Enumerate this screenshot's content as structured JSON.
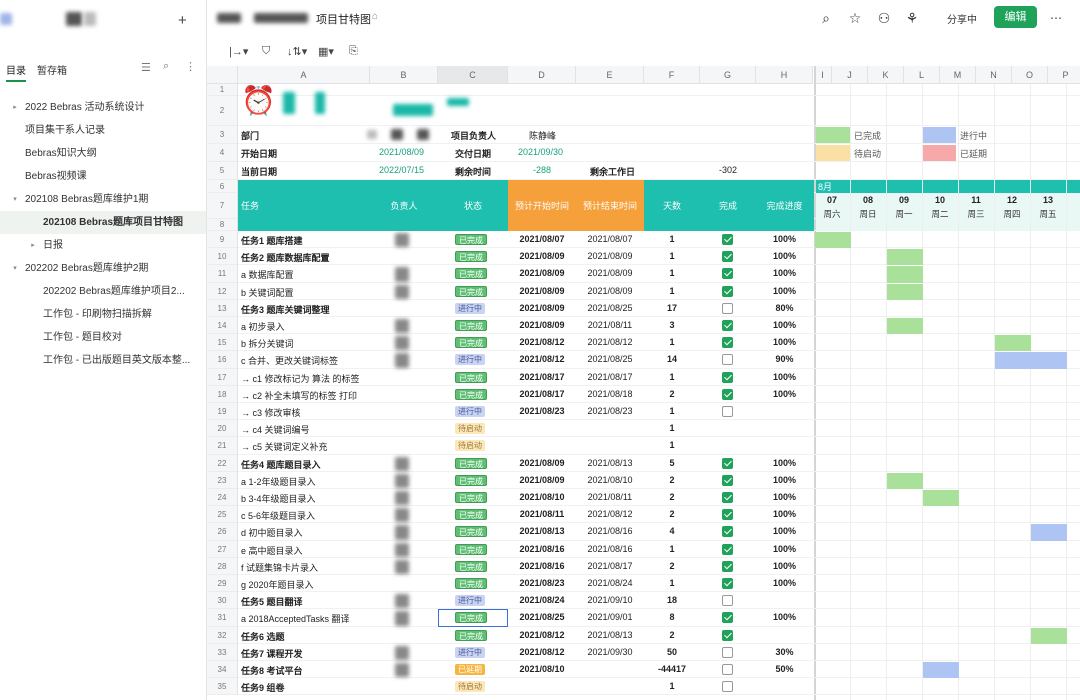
{
  "app": {
    "doc_title": "项目甘特图",
    "share_label": "分享中",
    "edit_label": "编辑"
  },
  "sidebar": {
    "tabs": [
      "目录",
      "暂存箱"
    ],
    "items": [
      {
        "label": "2022 Bebras 活动系统设计",
        "indent": 0,
        "caret": "right"
      },
      {
        "label": "项目集干系人记录",
        "indent": 0,
        "caret": ""
      },
      {
        "label": "Bebras知识大纲",
        "indent": 0,
        "caret": ""
      },
      {
        "label": "Bebras视频课",
        "indent": 0,
        "caret": ""
      },
      {
        "label": "202108 Bebras题库维护1期",
        "indent": 0,
        "caret": "down"
      },
      {
        "label": "202108 Bebras题库项目甘特图",
        "indent": 1,
        "caret": "",
        "selected": true
      },
      {
        "label": "日报",
        "indent": 1,
        "caret": "right"
      },
      {
        "label": "202202 Bebras题库维护2期",
        "indent": 0,
        "caret": "down"
      },
      {
        "label": "202202 Bebras题库维护项目2...",
        "indent": 1,
        "caret": ""
      },
      {
        "label": "工作包 - 印刷物扫描拆解",
        "indent": 1,
        "caret": ""
      },
      {
        "label": "工作包 - 题目校对",
        "indent": 1,
        "caret": ""
      },
      {
        "label": "工作包 - 已出版题目英文版本整...",
        "indent": 1,
        "caret": ""
      }
    ]
  },
  "toolbar": {
    "tools": [
      "|→▾",
      "⛉",
      "↓⇅▾",
      "▦▾",
      "⎘"
    ]
  },
  "columns": [
    "A",
    "B",
    "C",
    "D",
    "E",
    "F",
    "G",
    "H",
    "I",
    "J",
    "K",
    "L",
    "M",
    "N",
    "O",
    "P"
  ],
  "info": {
    "dept_label": "部门",
    "lead_label": "项目负责人",
    "lead_value": "陈静峰",
    "start_label": "开始日期",
    "start_value": "2021/08/09",
    "deliver_label": "交付日期",
    "deliver_value": "2021/09/30",
    "today_label": "当前日期",
    "today_value": "2022/07/15",
    "remain_label": "剩余时间",
    "remain_value": "-288",
    "remain_work_label": "剩余工作日",
    "remain_work_value": "-302"
  },
  "legend": [
    {
      "label": "已完成",
      "color": "#a9e09a"
    },
    {
      "label": "进行中",
      "color": "#aec4f2"
    },
    {
      "label": "待启动",
      "color": "#fbe0a5"
    },
    {
      "label": "已延期",
      "color": "#f7a8a8"
    }
  ],
  "table_header": {
    "task": "任务",
    "owner": "负责人",
    "status": "状态",
    "plan_start": "预计开始时间",
    "plan_end": "预计结束时间",
    "days": "天数",
    "done": "完成",
    "progress": "完成进度"
  },
  "gantt": {
    "month": "8月",
    "days": [
      {
        "num": "07",
        "dow": "周六"
      },
      {
        "num": "08",
        "dow": "周日"
      },
      {
        "num": "09",
        "dow": "周一"
      },
      {
        "num": "10",
        "dow": "周二"
      },
      {
        "num": "11",
        "dow": "周三"
      },
      {
        "num": "12",
        "dow": "周四"
      },
      {
        "num": "13",
        "dow": "周五"
      },
      {
        "num": "",
        "dow": "周"
      }
    ]
  },
  "rows": [
    {
      "n": "9",
      "task": "任务1 题库搭建",
      "bold": true,
      "status": "已完成",
      "start": "2021/08/07",
      "end": "2021/08/07",
      "days": "1",
      "done": true,
      "pct": "100%",
      "bars": [
        [
          0,
          1,
          "g"
        ]
      ]
    },
    {
      "n": "10",
      "task": "任务2 题库数据库配置",
      "bold": true,
      "status": "已完成",
      "start": "2021/08/09",
      "end": "2021/08/09",
      "days": "1",
      "done": true,
      "pct": "100%",
      "bars": [
        [
          2,
          1,
          "g"
        ]
      ]
    },
    {
      "n": "11",
      "task": "a 数据库配置",
      "status": "已完成",
      "start": "2021/08/09",
      "end": "2021/08/09",
      "days": "1",
      "done": true,
      "pct": "100%",
      "bars": [
        [
          2,
          1,
          "g"
        ]
      ]
    },
    {
      "n": "12",
      "task": "b 关键词配置",
      "status": "已完成",
      "start": "2021/08/09",
      "end": "2021/08/09",
      "days": "1",
      "done": true,
      "pct": "100%",
      "bars": [
        [
          2,
          1,
          "g"
        ]
      ]
    },
    {
      "n": "13",
      "task": "任务3 题库关键词整理",
      "bold": true,
      "status": "进行中",
      "start": "2021/08/09",
      "end": "2021/08/25",
      "days": "17",
      "done": false,
      "pct": "80%",
      "bars": []
    },
    {
      "n": "14",
      "task": "a 初步录入",
      "status": "已完成",
      "start": "2021/08/09",
      "end": "2021/08/11",
      "days": "3",
      "done": true,
      "pct": "100%",
      "bars": [
        [
          2,
          1,
          "g"
        ]
      ]
    },
    {
      "n": "15",
      "task": "b 拆分关键词",
      "status": "已完成",
      "start": "2021/08/12",
      "end": "2021/08/12",
      "days": "1",
      "done": true,
      "pct": "100%",
      "bars": [
        [
          5,
          1,
          "g"
        ]
      ]
    },
    {
      "n": "16",
      "task": "c 合并、更改关键词标签",
      "status": "进行中",
      "start": "2021/08/12",
      "end": "2021/08/25",
      "days": "14",
      "done": false,
      "pct": "90%",
      "bars": [
        [
          5,
          2,
          "b"
        ]
      ]
    },
    {
      "n": "17",
      "task": "→ c1 修改标记为 算法 的标签",
      "status": "已完成",
      "start": "2021/08/17",
      "end": "2021/08/17",
      "days": "1",
      "done": true,
      "pct": "100%",
      "bars": []
    },
    {
      "n": "18",
      "task": "→ c2 补全未填写的标签 打印",
      "status": "已完成",
      "start": "2021/08/17",
      "end": "2021/08/18",
      "days": "2",
      "done": true,
      "pct": "100%",
      "bars": []
    },
    {
      "n": "19",
      "task": "→ c3 修改审核",
      "status": "进行中",
      "start": "2021/08/23",
      "end": "2021/08/23",
      "days": "1",
      "done": false,
      "pct": "",
      "bars": []
    },
    {
      "n": "20",
      "task": "→ c4 关键词编号",
      "status": "待启动",
      "start": "",
      "end": "",
      "days": "1",
      "done": null,
      "pct": "",
      "bars": []
    },
    {
      "n": "21",
      "task": "→ c5 关键词定义补充",
      "status": "待启动",
      "start": "",
      "end": "",
      "days": "1",
      "done": null,
      "pct": "",
      "bars": []
    },
    {
      "n": "22",
      "task": "任务4 题库题目录入",
      "bold": true,
      "status": "已完成",
      "start": "2021/08/09",
      "end": "2021/08/13",
      "days": "5",
      "done": true,
      "pct": "100%",
      "bars": []
    },
    {
      "n": "23",
      "task": "a 1-2年级题目录入",
      "status": "已完成",
      "start": "2021/08/09",
      "end": "2021/08/10",
      "days": "2",
      "done": true,
      "pct": "100%",
      "bars": [
        [
          2,
          1,
          "g"
        ]
      ]
    },
    {
      "n": "24",
      "task": "b 3-4年级题目录入",
      "status": "已完成",
      "start": "2021/08/10",
      "end": "2021/08/11",
      "days": "2",
      "done": true,
      "pct": "100%",
      "bars": [
        [
          3,
          1,
          "g"
        ]
      ]
    },
    {
      "n": "25",
      "task": "c 5-6年级题目录入",
      "status": "已完成",
      "start": "2021/08/11",
      "end": "2021/08/12",
      "days": "2",
      "done": true,
      "pct": "100%",
      "bars": []
    },
    {
      "n": "26",
      "task": "d 初中题目录入",
      "status": "已完成",
      "start": "2021/08/13",
      "end": "2021/08/16",
      "days": "4",
      "done": true,
      "pct": "100%",
      "bars": [
        [
          6,
          1,
          "b"
        ]
      ]
    },
    {
      "n": "27",
      "task": "e 高中题目录入",
      "status": "已完成",
      "start": "2021/08/16",
      "end": "2021/08/16",
      "days": "1",
      "done": true,
      "pct": "100%",
      "bars": []
    },
    {
      "n": "28",
      "task": "f 试题集锦卡片录入",
      "status": "已完成",
      "start": "2021/08/16",
      "end": "2021/08/17",
      "days": "2",
      "done": true,
      "pct": "100%",
      "bars": []
    },
    {
      "n": "29",
      "task": "g 2020年题目录入",
      "status": "已完成",
      "start": "2021/08/23",
      "end": "2021/08/24",
      "days": "1",
      "done": true,
      "pct": "100%",
      "bars": []
    },
    {
      "n": "30",
      "task": "任务5 题目翻译",
      "bold": true,
      "status": "进行中",
      "start": "2021/08/24",
      "end": "2021/09/10",
      "days": "18",
      "done": false,
      "pct": "",
      "bars": []
    },
    {
      "n": "31",
      "task": "a 2018AcceptedTasks 翻译",
      "status": "已完成",
      "start": "2021/08/25",
      "end": "2021/09/01",
      "days": "8",
      "done": true,
      "pct": "100%",
      "bars": []
    },
    {
      "n": "32",
      "task": "任务6 选题",
      "bold": true,
      "status": "已完成",
      "start": "2021/08/12",
      "end": "2021/08/13",
      "days": "2",
      "done": true,
      "pct": "",
      "bars": [
        [
          6,
          1,
          "g"
        ]
      ]
    },
    {
      "n": "33",
      "task": "任务7 课程开发",
      "bold": true,
      "status": "进行中",
      "start": "2021/08/12",
      "end": "2021/09/30",
      "days": "50",
      "done": false,
      "pct": "30%",
      "bars": []
    },
    {
      "n": "34",
      "task": "任务8 考试平台",
      "bold": true,
      "status": "已延期",
      "start": "2021/08/10",
      "end": "",
      "days": "-44417",
      "done": false,
      "pct": "50%",
      "bars": [
        [
          3,
          1,
          "b"
        ]
      ]
    },
    {
      "n": "35",
      "task": "任务9 组卷",
      "bold": true,
      "status": "待启动",
      "start": "",
      "end": "",
      "days": "1",
      "done": false,
      "pct": "",
      "bars": []
    }
  ],
  "colors": {
    "teal": "#1fbfb0",
    "orange": "#f5a03a",
    "green": "#1fa35a",
    "bar_green": "#a9e09a",
    "bar_blue": "#aec4f2"
  }
}
